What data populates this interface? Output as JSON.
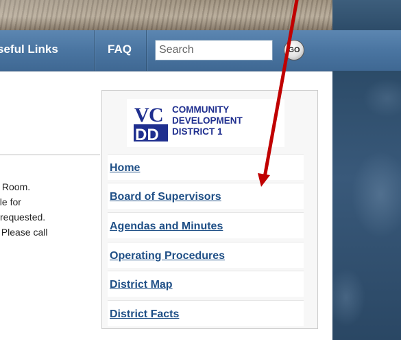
{
  "navbar": {
    "useful_links": "seful Links",
    "faq": "FAQ"
  },
  "search": {
    "placeholder": "Search",
    "go_label": "GO"
  },
  "body_text": {
    "line1": "s Room.",
    "line2": "ble for",
    "line3": "D requested.",
    "line4": ". Please call"
  },
  "logo": {
    "letters": "VCDD",
    "line1": "COMMUNITY",
    "line2": "DEVELOPMENT",
    "line3": "DISTRICT 1"
  },
  "sidebar": {
    "items": [
      {
        "label": "Home"
      },
      {
        "label": "Board of Supervisors"
      },
      {
        "label": "Agendas and Minutes"
      },
      {
        "label": "Operating Procedures"
      },
      {
        "label": "District Map"
      },
      {
        "label": "District Facts"
      }
    ]
  },
  "annotation": {
    "arrow_color": "#c00000"
  }
}
